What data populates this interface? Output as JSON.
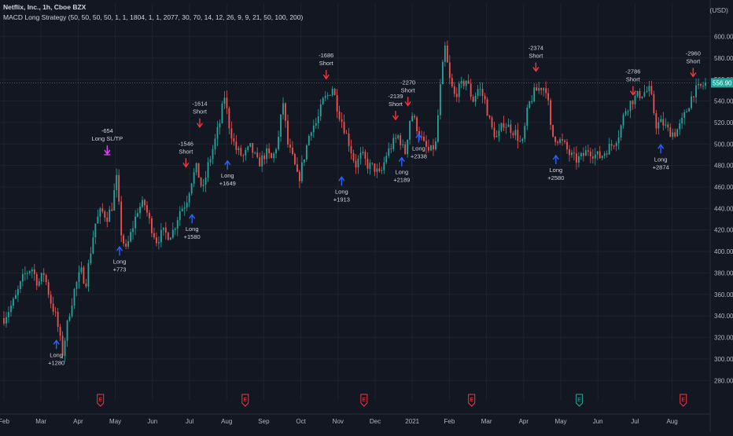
{
  "header": {
    "symbol": "Netflix, Inc., 1h, Cboe BZX",
    "indicator": "MACD Long Strategy (50, 50, 50, 50, 1, 1, 1804, 1, 1, 2077, 30, 70, 14, 12, 26, 9, 9, 21, 50, 100, 200)",
    "currency": "USD"
  },
  "colors": {
    "background": "#131722",
    "grid": "#1e222d",
    "axis_text": "#b2b5be",
    "candle_up": "#26a69a",
    "candle_down": "#ef5350",
    "long_arrow": "#2962ff",
    "short_arrow": "#f23645",
    "exit_arrow": "#e040fb",
    "last_price_bg": "#26a69a",
    "earnings_past": "#f23645",
    "earnings_future": "#26a69a"
  },
  "chart_data": {
    "type": "candlestick",
    "ylim": [
      270,
      612
    ],
    "y_ticks": [
      "280.00",
      "300.00",
      "320.00",
      "340.00",
      "360.00",
      "380.00",
      "400.00",
      "420.00",
      "440.00",
      "460.00",
      "480.00",
      "500.00",
      "520.00",
      "540.00",
      "560.00",
      "580.00",
      "600.00"
    ],
    "x_ticks": [
      "Feb",
      "Mar",
      "Apr",
      "May",
      "Jun",
      "Jul",
      "Aug",
      "Sep",
      "Oct",
      "Nov",
      "Dec",
      "2021",
      "Feb",
      "Mar",
      "Apr",
      "May",
      "Jun",
      "Jul",
      "Aug"
    ],
    "last_price": 556.9,
    "last_price_label": "556.90",
    "price_path": [
      {
        "t": 0,
        "p": 338
      },
      {
        "t": 0.7,
        "p": 355
      },
      {
        "t": 1.3,
        "p": 378
      },
      {
        "t": 1.8,
        "p": 385
      },
      {
        "t": 2.2,
        "p": 370
      },
      {
        "t": 2.6,
        "p": 380
      },
      {
        "t": 3.0,
        "p": 355
      },
      {
        "t": 3.4,
        "p": 338
      },
      {
        "t": 3.8,
        "p": 305
      },
      {
        "t": 4.2,
        "p": 340
      },
      {
        "t": 4.6,
        "p": 366
      },
      {
        "t": 5.0,
        "p": 382
      },
      {
        "t": 5.3,
        "p": 370
      },
      {
        "t": 5.6,
        "p": 398
      },
      {
        "t": 5.9,
        "p": 425
      },
      {
        "t": 6.3,
        "p": 438
      },
      {
        "t": 6.7,
        "p": 432
      },
      {
        "t": 7.0,
        "p": 442
      },
      {
        "t": 7.3,
        "p": 468
      },
      {
        "t": 7.6,
        "p": 418
      },
      {
        "t": 7.9,
        "p": 400
      },
      {
        "t": 8.3,
        "p": 420
      },
      {
        "t": 8.7,
        "p": 440
      },
      {
        "t": 9.1,
        "p": 445
      },
      {
        "t": 9.5,
        "p": 425
      },
      {
        "t": 9.9,
        "p": 410
      },
      {
        "t": 10.3,
        "p": 418
      },
      {
        "t": 10.7,
        "p": 415
      },
      {
        "t": 11.0,
        "p": 420
      },
      {
        "t": 11.4,
        "p": 438
      },
      {
        "t": 11.8,
        "p": 445
      },
      {
        "t": 12.2,
        "p": 468
      },
      {
        "t": 12.5,
        "p": 478
      },
      {
        "t": 12.9,
        "p": 455
      },
      {
        "t": 13.2,
        "p": 478
      },
      {
        "t": 13.6,
        "p": 498
      },
      {
        "t": 14.0,
        "p": 520
      },
      {
        "t": 14.3,
        "p": 545
      },
      {
        "t": 14.6,
        "p": 518
      },
      {
        "t": 15.0,
        "p": 496
      },
      {
        "t": 15.5,
        "p": 488
      },
      {
        "t": 16.0,
        "p": 497
      },
      {
        "t": 16.5,
        "p": 481
      },
      {
        "t": 17.0,
        "p": 492
      },
      {
        "t": 17.4,
        "p": 485
      },
      {
        "t": 17.8,
        "p": 505
      },
      {
        "t": 18.1,
        "p": 540
      },
      {
        "t": 18.4,
        "p": 500
      },
      {
        "t": 18.8,
        "p": 483
      },
      {
        "t": 19.1,
        "p": 465
      },
      {
        "t": 19.5,
        "p": 490
      },
      {
        "t": 19.9,
        "p": 515
      },
      {
        "t": 20.3,
        "p": 520
      },
      {
        "t": 20.7,
        "p": 540
      },
      {
        "t": 21.0,
        "p": 545
      },
      {
        "t": 21.3,
        "p": 553
      },
      {
        "t": 21.7,
        "p": 530
      },
      {
        "t": 22.0,
        "p": 518
      },
      {
        "t": 22.4,
        "p": 500
      },
      {
        "t": 22.8,
        "p": 480
      },
      {
        "t": 23.2,
        "p": 490
      },
      {
        "t": 23.6,
        "p": 480
      },
      {
        "t": 24.0,
        "p": 478
      },
      {
        "t": 24.4,
        "p": 470
      },
      {
        "t": 24.8,
        "p": 490
      },
      {
        "t": 25.2,
        "p": 500
      },
      {
        "t": 25.6,
        "p": 508
      },
      {
        "t": 26.0,
        "p": 490
      },
      {
        "t": 26.4,
        "p": 530
      },
      {
        "t": 26.8,
        "p": 515
      },
      {
        "t": 27.2,
        "p": 500
      },
      {
        "t": 27.6,
        "p": 492
      },
      {
        "t": 28.0,
        "p": 500
      },
      {
        "t": 28.3,
        "p": 552
      },
      {
        "t": 28.6,
        "p": 590
      },
      {
        "t": 28.9,
        "p": 560
      },
      {
        "t": 29.2,
        "p": 545
      },
      {
        "t": 29.6,
        "p": 553
      },
      {
        "t": 30.0,
        "p": 560
      },
      {
        "t": 30.4,
        "p": 540
      },
      {
        "t": 30.8,
        "p": 553
      },
      {
        "t": 31.2,
        "p": 540
      },
      {
        "t": 31.6,
        "p": 515
      },
      {
        "t": 32.0,
        "p": 505
      },
      {
        "t": 32.4,
        "p": 520
      },
      {
        "t": 32.8,
        "p": 515
      },
      {
        "t": 33.2,
        "p": 510
      },
      {
        "t": 33.6,
        "p": 498
      },
      {
        "t": 34.0,
        "p": 535
      },
      {
        "t": 34.4,
        "p": 548
      },
      {
        "t": 34.8,
        "p": 553
      },
      {
        "t": 35.2,
        "p": 552
      },
      {
        "t": 35.5,
        "p": 508
      },
      {
        "t": 35.9,
        "p": 505
      },
      {
        "t": 36.3,
        "p": 500
      },
      {
        "t": 36.7,
        "p": 490
      },
      {
        "t": 37.1,
        "p": 485
      },
      {
        "t": 37.5,
        "p": 488
      },
      {
        "t": 37.9,
        "p": 495
      },
      {
        "t": 38.3,
        "p": 490
      },
      {
        "t": 38.7,
        "p": 488
      },
      {
        "t": 39.1,
        "p": 495
      },
      {
        "t": 39.5,
        "p": 500
      },
      {
        "t": 39.9,
        "p": 510
      },
      {
        "t": 40.3,
        "p": 532
      },
      {
        "t": 40.7,
        "p": 540
      },
      {
        "t": 41.1,
        "p": 545
      },
      {
        "t": 41.5,
        "p": 548
      },
      {
        "t": 41.9,
        "p": 550
      },
      {
        "t": 42.3,
        "p": 518
      },
      {
        "t": 42.7,
        "p": 520
      },
      {
        "t": 43.1,
        "p": 512
      },
      {
        "t": 43.5,
        "p": 510
      },
      {
        "t": 43.9,
        "p": 518
      },
      {
        "t": 44.3,
        "p": 532
      },
      {
        "t": 44.7,
        "p": 548
      },
      {
        "t": 45.1,
        "p": 552
      },
      {
        "t": 45.5,
        "p": 556
      }
    ],
    "total_units": 45.5,
    "signals": [
      {
        "kind": "long",
        "t": 3.4,
        "p": 318,
        "label": [
          "Long",
          "+1280"
        ]
      },
      {
        "kind": "exit",
        "t": 6.7,
        "p": 490,
        "label": [
          "-654",
          "Long  SL/TP"
        ]
      },
      {
        "kind": "long",
        "t": 7.5,
        "p": 405,
        "label": [
          "Long",
          "+773"
        ]
      },
      {
        "kind": "short",
        "t": 11.8,
        "p": 478,
        "label": [
          "-1546",
          "Short"
        ]
      },
      {
        "kind": "long",
        "t": 12.2,
        "p": 435,
        "label": [
          "Long",
          "+1580"
        ]
      },
      {
        "kind": "short",
        "t": 12.7,
        "p": 515,
        "label": [
          "-1614",
          "Short"
        ]
      },
      {
        "kind": "long",
        "t": 14.5,
        "p": 485,
        "label": [
          "Long",
          "+1649"
        ]
      },
      {
        "kind": "short",
        "t": 20.9,
        "p": 560,
        "label": [
          "-1686",
          "Short"
        ]
      },
      {
        "kind": "long",
        "t": 21.9,
        "p": 470,
        "label": [
          "Long",
          "+1913"
        ]
      },
      {
        "kind": "short",
        "t": 25.4,
        "p": 522,
        "label": [
          "-2139",
          "Short"
        ]
      },
      {
        "kind": "long",
        "t": 25.8,
        "p": 488,
        "label": [
          "Long",
          "+2189"
        ]
      },
      {
        "kind": "short",
        "t": 26.2,
        "p": 535,
        "label": [
          "-2270",
          "Short"
        ]
      },
      {
        "kind": "long",
        "t": 26.9,
        "p": 510,
        "label": [
          "Long",
          "+2338"
        ]
      },
      {
        "kind": "long",
        "t": 35.8,
        "p": 490,
        "label": [
          "Long",
          "+2580"
        ]
      },
      {
        "kind": "short",
        "t": 34.5,
        "p": 567,
        "label": [
          "-2374",
          "Short"
        ]
      },
      {
        "kind": "short",
        "t": 40.8,
        "p": 545,
        "label": [
          "-2786",
          "Short"
        ]
      },
      {
        "kind": "long",
        "t": 42.6,
        "p": 500,
        "label": [
          "Long",
          "+2874"
        ]
      },
      {
        "kind": "short",
        "t": 44.7,
        "p": 562,
        "label": [
          "-2960",
          "Short"
        ]
      }
    ],
    "earnings": [
      {
        "x_month_index": 2.6,
        "state": "past",
        "label": "E"
      },
      {
        "x_month_index": 6.5,
        "state": "past",
        "label": "E"
      },
      {
        "x_month_index": 9.7,
        "state": "past",
        "label": "E"
      },
      {
        "x_month_index": 12.6,
        "state": "past",
        "label": "E"
      },
      {
        "x_month_index": 15.5,
        "state": "future",
        "label": "E"
      },
      {
        "x_month_index": 18.3,
        "state": "past",
        "label": "E"
      }
    ]
  }
}
